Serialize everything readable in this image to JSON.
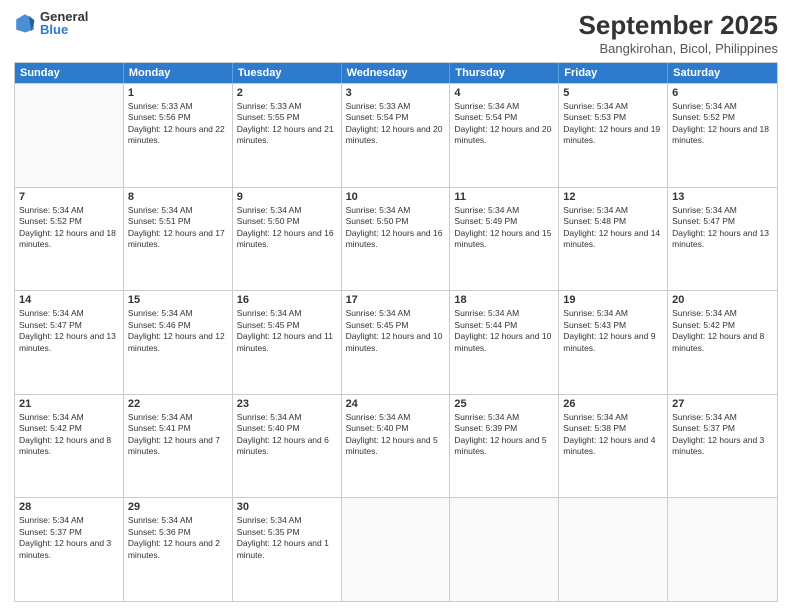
{
  "header": {
    "logo_general": "General",
    "logo_blue": "Blue",
    "month_title": "September 2025",
    "location": "Bangkirohan, Bicol, Philippines"
  },
  "days_of_week": [
    "Sunday",
    "Monday",
    "Tuesday",
    "Wednesday",
    "Thursday",
    "Friday",
    "Saturday"
  ],
  "weeks": [
    [
      {
        "day": null
      },
      {
        "day": 1,
        "sunrise": "Sunrise: 5:33 AM",
        "sunset": "Sunset: 5:56 PM",
        "daylight": "Daylight: 12 hours and 22 minutes."
      },
      {
        "day": 2,
        "sunrise": "Sunrise: 5:33 AM",
        "sunset": "Sunset: 5:55 PM",
        "daylight": "Daylight: 12 hours and 21 minutes."
      },
      {
        "day": 3,
        "sunrise": "Sunrise: 5:33 AM",
        "sunset": "Sunset: 5:54 PM",
        "daylight": "Daylight: 12 hours and 20 minutes."
      },
      {
        "day": 4,
        "sunrise": "Sunrise: 5:34 AM",
        "sunset": "Sunset: 5:54 PM",
        "daylight": "Daylight: 12 hours and 20 minutes."
      },
      {
        "day": 5,
        "sunrise": "Sunrise: 5:34 AM",
        "sunset": "Sunset: 5:53 PM",
        "daylight": "Daylight: 12 hours and 19 minutes."
      },
      {
        "day": 6,
        "sunrise": "Sunrise: 5:34 AM",
        "sunset": "Sunset: 5:52 PM",
        "daylight": "Daylight: 12 hours and 18 minutes."
      }
    ],
    [
      {
        "day": 7,
        "sunrise": "Sunrise: 5:34 AM",
        "sunset": "Sunset: 5:52 PM",
        "daylight": "Daylight: 12 hours and 18 minutes."
      },
      {
        "day": 8,
        "sunrise": "Sunrise: 5:34 AM",
        "sunset": "Sunset: 5:51 PM",
        "daylight": "Daylight: 12 hours and 17 minutes."
      },
      {
        "day": 9,
        "sunrise": "Sunrise: 5:34 AM",
        "sunset": "Sunset: 5:50 PM",
        "daylight": "Daylight: 12 hours and 16 minutes."
      },
      {
        "day": 10,
        "sunrise": "Sunrise: 5:34 AM",
        "sunset": "Sunset: 5:50 PM",
        "daylight": "Daylight: 12 hours and 16 minutes."
      },
      {
        "day": 11,
        "sunrise": "Sunrise: 5:34 AM",
        "sunset": "Sunset: 5:49 PM",
        "daylight": "Daylight: 12 hours and 15 minutes."
      },
      {
        "day": 12,
        "sunrise": "Sunrise: 5:34 AM",
        "sunset": "Sunset: 5:48 PM",
        "daylight": "Daylight: 12 hours and 14 minutes."
      },
      {
        "day": 13,
        "sunrise": "Sunrise: 5:34 AM",
        "sunset": "Sunset: 5:47 PM",
        "daylight": "Daylight: 12 hours and 13 minutes."
      }
    ],
    [
      {
        "day": 14,
        "sunrise": "Sunrise: 5:34 AM",
        "sunset": "Sunset: 5:47 PM",
        "daylight": "Daylight: 12 hours and 13 minutes."
      },
      {
        "day": 15,
        "sunrise": "Sunrise: 5:34 AM",
        "sunset": "Sunset: 5:46 PM",
        "daylight": "Daylight: 12 hours and 12 minutes."
      },
      {
        "day": 16,
        "sunrise": "Sunrise: 5:34 AM",
        "sunset": "Sunset: 5:45 PM",
        "daylight": "Daylight: 12 hours and 11 minutes."
      },
      {
        "day": 17,
        "sunrise": "Sunrise: 5:34 AM",
        "sunset": "Sunset: 5:45 PM",
        "daylight": "Daylight: 12 hours and 10 minutes."
      },
      {
        "day": 18,
        "sunrise": "Sunrise: 5:34 AM",
        "sunset": "Sunset: 5:44 PM",
        "daylight": "Daylight: 12 hours and 10 minutes."
      },
      {
        "day": 19,
        "sunrise": "Sunrise: 5:34 AM",
        "sunset": "Sunset: 5:43 PM",
        "daylight": "Daylight: 12 hours and 9 minutes."
      },
      {
        "day": 20,
        "sunrise": "Sunrise: 5:34 AM",
        "sunset": "Sunset: 5:42 PM",
        "daylight": "Daylight: 12 hours and 8 minutes."
      }
    ],
    [
      {
        "day": 21,
        "sunrise": "Sunrise: 5:34 AM",
        "sunset": "Sunset: 5:42 PM",
        "daylight": "Daylight: 12 hours and 8 minutes."
      },
      {
        "day": 22,
        "sunrise": "Sunrise: 5:34 AM",
        "sunset": "Sunset: 5:41 PM",
        "daylight": "Daylight: 12 hours and 7 minutes."
      },
      {
        "day": 23,
        "sunrise": "Sunrise: 5:34 AM",
        "sunset": "Sunset: 5:40 PM",
        "daylight": "Daylight: 12 hours and 6 minutes."
      },
      {
        "day": 24,
        "sunrise": "Sunrise: 5:34 AM",
        "sunset": "Sunset: 5:40 PM",
        "daylight": "Daylight: 12 hours and 5 minutes."
      },
      {
        "day": 25,
        "sunrise": "Sunrise: 5:34 AM",
        "sunset": "Sunset: 5:39 PM",
        "daylight": "Daylight: 12 hours and 5 minutes."
      },
      {
        "day": 26,
        "sunrise": "Sunrise: 5:34 AM",
        "sunset": "Sunset: 5:38 PM",
        "daylight": "Daylight: 12 hours and 4 minutes."
      },
      {
        "day": 27,
        "sunrise": "Sunrise: 5:34 AM",
        "sunset": "Sunset: 5:37 PM",
        "daylight": "Daylight: 12 hours and 3 minutes."
      }
    ],
    [
      {
        "day": 28,
        "sunrise": "Sunrise: 5:34 AM",
        "sunset": "Sunset: 5:37 PM",
        "daylight": "Daylight: 12 hours and 3 minutes."
      },
      {
        "day": 29,
        "sunrise": "Sunrise: 5:34 AM",
        "sunset": "Sunset: 5:36 PM",
        "daylight": "Daylight: 12 hours and 2 minutes."
      },
      {
        "day": 30,
        "sunrise": "Sunrise: 5:34 AM",
        "sunset": "Sunset: 5:35 PM",
        "daylight": "Daylight: 12 hours and 1 minute."
      },
      {
        "day": null
      },
      {
        "day": null
      },
      {
        "day": null
      },
      {
        "day": null
      }
    ]
  ]
}
